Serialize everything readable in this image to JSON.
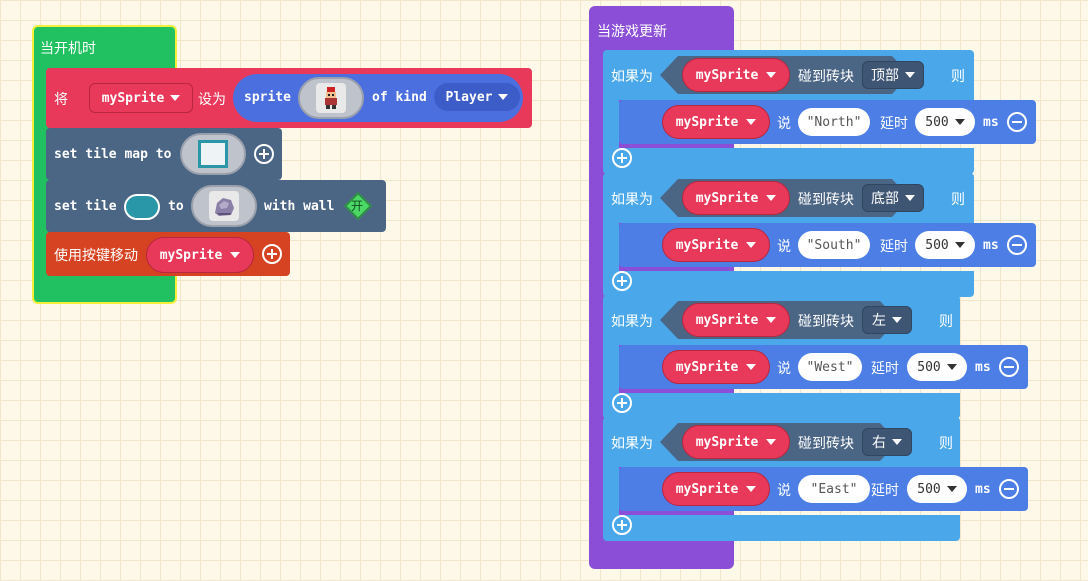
{
  "colors": {
    "event_green": "#21c060",
    "event_border": "#f5ef3a",
    "sprite_red": "#e8395a",
    "sprite_blue": "#4c6fe0",
    "scene_slate": "#4b6584",
    "controller_orange": "#d54322",
    "game_purple": "#8a4fd6",
    "logic_blue": "#4aa8ea",
    "say_blue": "#4c7ee6"
  },
  "on_start": {
    "title": "当开机时",
    "set_block": {
      "prefix": "将",
      "variable": "mySprite",
      "set_to": "设为",
      "sprite_label": "sprite",
      "of_kind": "of kind",
      "kind": "Player"
    },
    "tile_map": {
      "label": "set tile map to"
    },
    "set_tile": {
      "label": "set tile",
      "to": "to",
      "with_wall": "with wall",
      "wall_toggle": "开"
    },
    "move": {
      "label": "使用按键移动",
      "sprite": "mySprite"
    }
  },
  "on_update": {
    "title": "当游戏更新",
    "branches": [
      {
        "if": "如果为",
        "sprite": "mySprite",
        "hits": "碰到砖块",
        "side": "顶部",
        "then": "则",
        "say_sprite": "mySprite",
        "say": "说",
        "text": "North",
        "delay": "延时",
        "ms_value": "500",
        "ms": "ms"
      },
      {
        "if": "如果为",
        "sprite": "mySprite",
        "hits": "碰到砖块",
        "side": "底部",
        "then": "则",
        "say_sprite": "mySprite",
        "say": "说",
        "text": "South",
        "delay": "延时",
        "ms_value": "500",
        "ms": "ms"
      },
      {
        "if": "如果为",
        "sprite": "mySprite",
        "hits": "碰到砖块",
        "side": "左",
        "then": "则",
        "say_sprite": "mySprite",
        "say": "说",
        "text": "West",
        "delay": "延时",
        "ms_value": "500",
        "ms": "ms"
      },
      {
        "if": "如果为",
        "sprite": "mySprite",
        "hits": "碰到砖块",
        "side": "右",
        "then": "则",
        "say_sprite": "mySprite",
        "say": "说",
        "text": "East",
        "delay": "延时",
        "ms_value": "500",
        "ms": "ms"
      }
    ]
  }
}
